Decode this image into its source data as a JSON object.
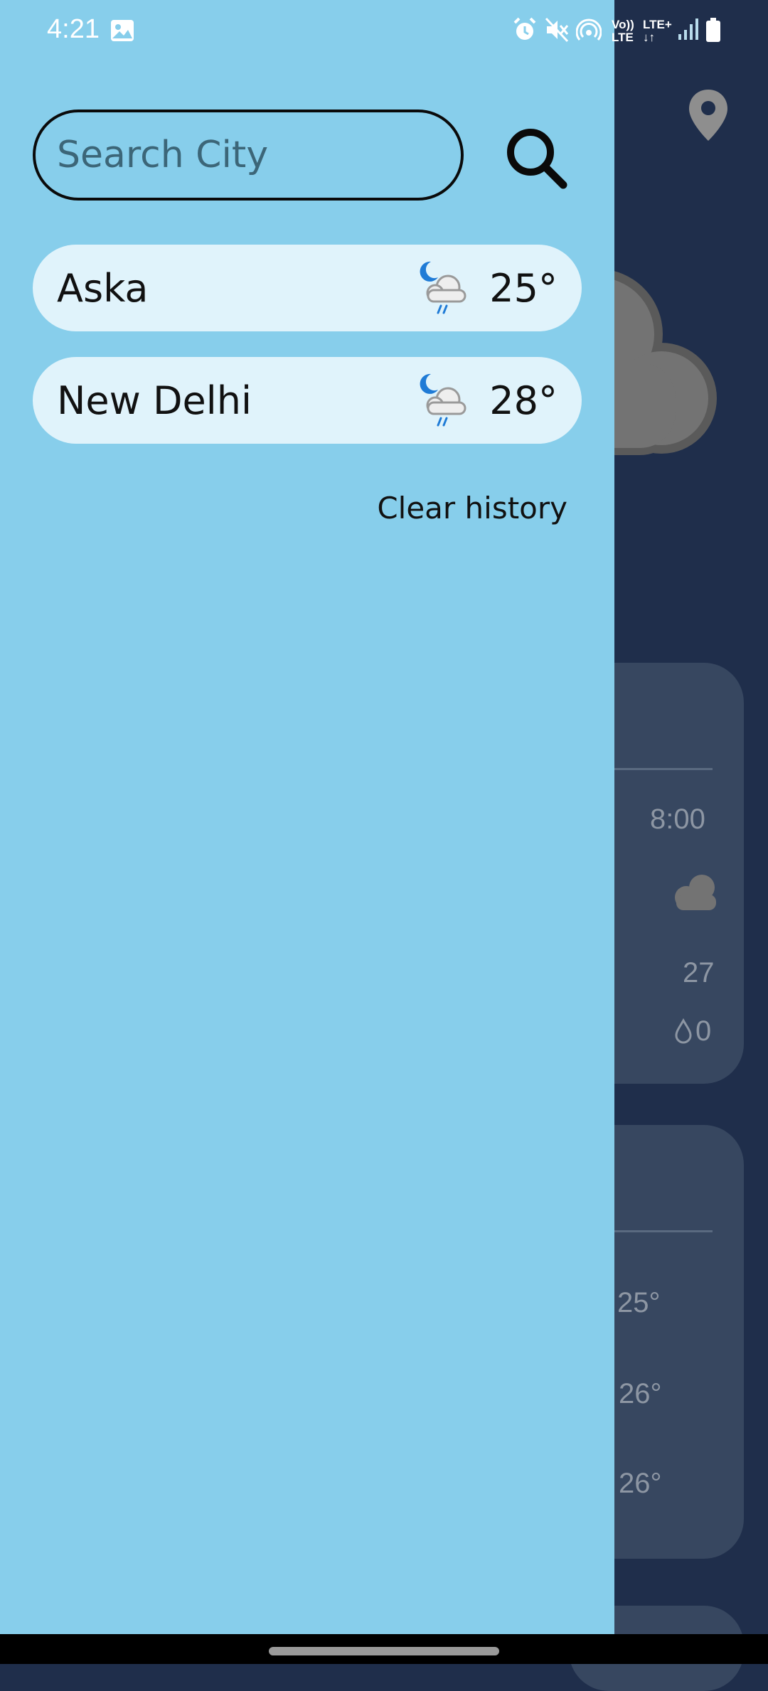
{
  "status_bar": {
    "time": "4:21",
    "network_label_top": "Vo))",
    "network_label_bottom": "LTE",
    "lte_label_top": "LTE+",
    "lte_label_bottom": "↓↑",
    "icons": [
      "gallery-icon",
      "alarm-icon",
      "mute-icon",
      "hotspot-icon",
      "signal-icon",
      "battery-icon"
    ]
  },
  "drawer": {
    "search": {
      "placeholder": "Search City",
      "value": ""
    },
    "history": [
      {
        "city": "Aska",
        "temperature": "25°",
        "icon": "night-rain-cloud-icon"
      },
      {
        "city": "New Delhi",
        "temperature": "28°",
        "icon": "night-rain-cloud-icon"
      }
    ],
    "clear_history_label": "Clear history"
  },
  "background_app": {
    "hourly_time": "8:00",
    "hourly_temp": "27",
    "hourly_rain": "0",
    "daily_temps": [
      "25°",
      "26°",
      "26°"
    ]
  },
  "colors": {
    "drawer_bg": "#87ceeb",
    "row_bg": "#e0f3fb",
    "app_bg": "#1f2e4b",
    "card_bg": "#374760",
    "icon_blue": "#1f7bd6"
  }
}
